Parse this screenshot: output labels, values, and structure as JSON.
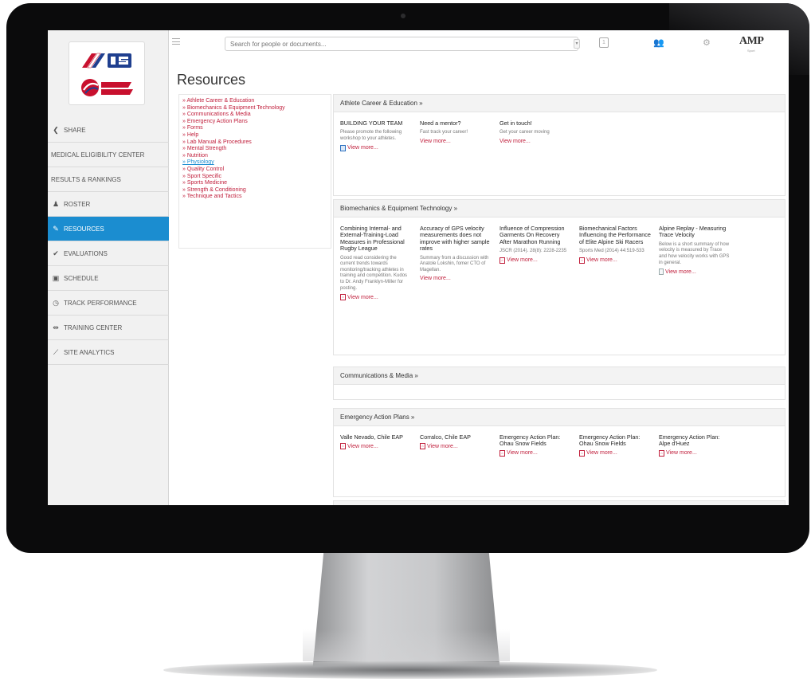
{
  "search": {
    "placeholder": "Search for people or documents..."
  },
  "topbar": {
    "notification_count": "1",
    "brand": "AMP",
    "brand_sub": "Sport"
  },
  "page": {
    "title": "Resources"
  },
  "sidebar": {
    "items": [
      {
        "label": "SHARE",
        "icon": "share-icon"
      },
      {
        "label": "MEDICAL ELIGIBILITY CENTER",
        "icon": ""
      },
      {
        "label": "RESULTS & RANKINGS",
        "icon": ""
      },
      {
        "label": "ROSTER",
        "icon": "people-icon"
      },
      {
        "label": "RESOURCES",
        "icon": "pin-icon",
        "active": true
      },
      {
        "label": "EVALUATIONS",
        "icon": "check-icon"
      },
      {
        "label": "SCHEDULE",
        "icon": "calendar-icon"
      },
      {
        "label": "TRACK PERFORMANCE",
        "icon": "stopwatch-icon"
      },
      {
        "label": "TRAINING CENTER",
        "icon": "dumbbell-icon"
      },
      {
        "label": "SITE ANALYTICS",
        "icon": "line-chart-icon"
      }
    ]
  },
  "resource_links": [
    "» Athlete Career & Education",
    "» Biomechanics & Equipment Technology",
    "» Communications & Media",
    "» Emergency Action Plans",
    "» Forms",
    "» Help",
    "» Lab Manual & Procedures",
    "» Mental Strength",
    "» Nutrition",
    "» Physiology",
    "» Quality Control",
    "» Sport Specific",
    "» Sports Medicine",
    "» Strength & Conditioning",
    "» Technique and Tactics"
  ],
  "sections": {
    "career": {
      "title": "Athlete Career & Education »",
      "cards": [
        {
          "title": "BUILDING YOUR TEAM",
          "desc": "Please promote the following workshop to your athletes.",
          "link": "View more...",
          "icon": "doc-icon"
        },
        {
          "title": "Need a mentor?",
          "desc": "Fast track your career!",
          "link": "View more...",
          "icon": ""
        },
        {
          "title": "Get in touch!",
          "desc": "Get your career moving",
          "link": "View more...",
          "icon": ""
        }
      ]
    },
    "biomech": {
      "title": "Biomechanics & Equipment Technology »",
      "cards": [
        {
          "title": "Combining Internal- and External-Training-Load Measures in Professional Rugby League",
          "desc": "Good read considering the current trends towards monitoring/tracking athletes in training and competition. Kudos to Dr. Andy Franklyn-Miller for posting.",
          "link": "View more...",
          "icon": "pdf-icon"
        },
        {
          "title": "Accuracy of GPS velocity measurements does not improve with higher sample rates",
          "desc": "Summary from a discussion with Anatole Lokshin, fomer CTO of Magellan.",
          "link": "View more...",
          "icon": ""
        },
        {
          "title": "Influence of Compression Garments On Recovery After Marathon Running",
          "desc": "JSCR (2014). 28(8): 2228-2235",
          "link": "View more...",
          "icon": "pdf-icon"
        },
        {
          "title": "Biomechanical Factors Influencing the Performance of Elite Alpine Ski Racers",
          "desc": "Sports Med (2014) 44:519-533",
          "link": "View more...",
          "icon": "pdf-icon"
        },
        {
          "title": "Alpine Replay - Measuring Trace Velocity",
          "desc": "Below is a short summary of how velocity is measured by Trace and how velocity works with GPS in general.",
          "link": "View more...",
          "icon": "file-icon"
        }
      ]
    },
    "comms": {
      "title": "Communications & Media »"
    },
    "eap": {
      "title": "Emergency Action Plans »",
      "cards": [
        {
          "title": "Valle Nevado, Chile EAP",
          "link": "View more...",
          "icon": "pdf-icon"
        },
        {
          "title": "Corralco, Chile EAP",
          "link": "View more...",
          "icon": "pdf-icon"
        },
        {
          "title": "Emergency Action Plan: Ohau Snow Fields",
          "link": "View more...",
          "icon": "pdf-icon"
        },
        {
          "title": "Emergency Action Plan: Ohau Snow Fields",
          "link": "View more...",
          "icon": "pdf-icon"
        },
        {
          "title": "Emergency Action Plan: Alpe d'Huez",
          "link": "View more...",
          "icon": "pdf-icon"
        }
      ]
    }
  },
  "colors": {
    "accent": "#1b8dd0",
    "link": "#c01e3b",
    "sidebar_bg": "#f1f1f1"
  }
}
